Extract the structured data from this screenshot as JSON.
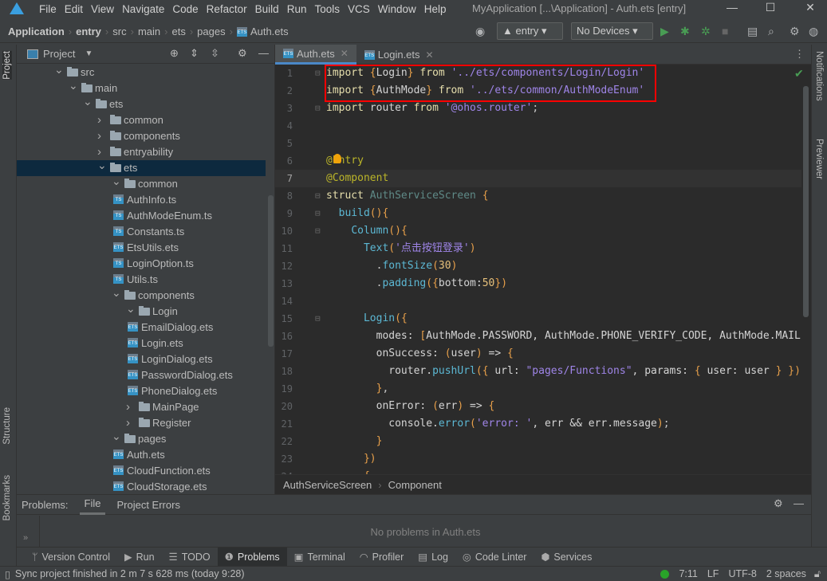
{
  "titlebar": {
    "menu": [
      "File",
      "Edit",
      "View",
      "Navigate",
      "Code",
      "Refactor",
      "Build",
      "Run",
      "Tools",
      "VCS",
      "Window",
      "Help"
    ],
    "title": "MyApplication [...\\Application] - Auth.ets [entry]"
  },
  "breadcrumb": [
    "Application",
    "entry",
    "src",
    "main",
    "ets",
    "pages",
    "Auth.ets"
  ],
  "toolbar": {
    "config": "entry",
    "device": "No Devices"
  },
  "left_strip": {
    "project": "Project",
    "structure": "Structure",
    "bookmarks": "Bookmarks"
  },
  "right_strip": {
    "notifications": "Notifications",
    "previewer": "Previewer"
  },
  "project_panel": {
    "title": "Project",
    "tree": [
      {
        "label": "src",
        "depth": 0,
        "type": "folder",
        "open": true
      },
      {
        "label": "main",
        "depth": 1,
        "type": "folder",
        "open": true
      },
      {
        "label": "ets",
        "depth": 2,
        "type": "folder",
        "open": true
      },
      {
        "label": "common",
        "depth": 3,
        "type": "folder",
        "open": false
      },
      {
        "label": "components",
        "depth": 3,
        "type": "folder",
        "open": false
      },
      {
        "label": "entryability",
        "depth": 3,
        "type": "folder",
        "open": false
      },
      {
        "label": "ets",
        "depth": 3,
        "type": "folder",
        "open": true,
        "selected": true
      },
      {
        "label": "common",
        "depth": 4,
        "type": "folder",
        "open": true
      },
      {
        "label": "AuthInfo.ts",
        "depth": 5,
        "type": "file"
      },
      {
        "label": "AuthModeEnum.ts",
        "depth": 5,
        "type": "file"
      },
      {
        "label": "Constants.ts",
        "depth": 5,
        "type": "file"
      },
      {
        "label": "EtsUtils.ets",
        "depth": 5,
        "type": "file"
      },
      {
        "label": "LoginOption.ts",
        "depth": 5,
        "type": "file"
      },
      {
        "label": "Utils.ts",
        "depth": 5,
        "type": "file"
      },
      {
        "label": "components",
        "depth": 4,
        "type": "folder",
        "open": true
      },
      {
        "label": "Login",
        "depth": 5,
        "type": "folder",
        "open": true
      },
      {
        "label": "EmailDialog.ets",
        "depth": 6,
        "type": "file"
      },
      {
        "label": "Login.ets",
        "depth": 6,
        "type": "file"
      },
      {
        "label": "LoginDialog.ets",
        "depth": 6,
        "type": "file"
      },
      {
        "label": "PasswordDialog.ets",
        "depth": 6,
        "type": "file"
      },
      {
        "label": "PhoneDialog.ets",
        "depth": 6,
        "type": "file"
      },
      {
        "label": "MainPage",
        "depth": 5,
        "type": "folder",
        "open": false
      },
      {
        "label": "Register",
        "depth": 5,
        "type": "folder",
        "open": false
      },
      {
        "label": "pages",
        "depth": 4,
        "type": "folder",
        "open": true
      },
      {
        "label": "Auth.ets",
        "depth": 5,
        "type": "file"
      },
      {
        "label": "CloudFunction.ets",
        "depth": 5,
        "type": "file"
      },
      {
        "label": "CloudStorage.ets",
        "depth": 5,
        "type": "file"
      }
    ]
  },
  "editor": {
    "tabs": [
      {
        "label": "Auth.ets",
        "active": true
      },
      {
        "label": "Login.ets",
        "active": false
      }
    ],
    "current_line": 7,
    "lines": [
      [
        [
          "import ",
          "k"
        ],
        [
          "{",
          "br"
        ],
        [
          "Login",
          "id"
        ],
        [
          "}",
          "br"
        ],
        [
          " from ",
          "k"
        ],
        [
          "'../ets/components/Login/Login'",
          "s"
        ]
      ],
      [
        [
          "import ",
          "k"
        ],
        [
          "{",
          "br"
        ],
        [
          "AuthMode",
          "id"
        ],
        [
          "}",
          "br"
        ],
        [
          " from ",
          "k"
        ],
        [
          "'../ets/common/AuthModeEnum'",
          "s"
        ]
      ],
      [
        [
          "import ",
          "k"
        ],
        [
          "router ",
          "id"
        ],
        [
          "from ",
          "k"
        ],
        [
          "'@ohos.router'",
          "s"
        ],
        [
          ";",
          "p"
        ]
      ],
      [],
      [],
      [
        [
          "@Entry",
          "d"
        ]
      ],
      [
        [
          "@Component",
          "d"
        ]
      ],
      [
        [
          "struct ",
          "k"
        ],
        [
          "AuthServiceScreen ",
          "cl"
        ],
        [
          "{",
          "br"
        ]
      ],
      [
        [
          "  ",
          " "
        ],
        [
          "build",
          "f"
        ],
        [
          "()",
          "br"
        ],
        [
          "{",
          "br"
        ]
      ],
      [
        [
          "    ",
          "p"
        ],
        [
          "Column",
          "f"
        ],
        [
          "()",
          "br"
        ],
        [
          "{",
          "br"
        ]
      ],
      [
        [
          "      ",
          "p"
        ],
        [
          "Text",
          "f"
        ],
        [
          "(",
          "br"
        ],
        [
          "'点击按钮登录'",
          "s"
        ],
        [
          ")",
          "br"
        ]
      ],
      [
        [
          "        .",
          "p"
        ],
        [
          "fontSize",
          "f"
        ],
        [
          "(",
          "br"
        ],
        [
          "30",
          "n"
        ],
        [
          ")",
          "br"
        ]
      ],
      [
        [
          "        .",
          "p"
        ],
        [
          "padding",
          "f"
        ],
        [
          "(",
          "br"
        ],
        [
          "{",
          "br"
        ],
        [
          "bottom:",
          "id"
        ],
        [
          "50",
          "n"
        ],
        [
          "}",
          "br"
        ],
        [
          ")",
          "br"
        ]
      ],
      [],
      [
        [
          "      ",
          "p"
        ],
        [
          "Login",
          "f"
        ],
        [
          "(",
          "br"
        ],
        [
          "{",
          "br"
        ]
      ],
      [
        [
          "        modes: ",
          "id"
        ],
        [
          "[",
          "br"
        ],
        [
          "AuthMode.PASSWORD, AuthMode.PHONE_VERIFY_CODE, AuthMode.MAIL",
          "id"
        ]
      ],
      [
        [
          "        onSuccess: ",
          "id"
        ],
        [
          "(",
          "br"
        ],
        [
          "user",
          "id"
        ],
        [
          ")",
          "br"
        ],
        [
          " => ",
          "id"
        ],
        [
          "{",
          "br"
        ]
      ],
      [
        [
          "          router.",
          "id"
        ],
        [
          "pushUrl",
          "f"
        ],
        [
          "(",
          "br"
        ],
        [
          "{",
          "br"
        ],
        [
          " url: ",
          "id"
        ],
        [
          "\"pages/Functions\"",
          "s"
        ],
        [
          ", params: ",
          "id"
        ],
        [
          "{",
          "br"
        ],
        [
          " user: user ",
          "id"
        ],
        [
          "}",
          "br"
        ],
        [
          " ",
          "p"
        ],
        [
          "}",
          "br"
        ],
        [
          ")",
          "br"
        ]
      ],
      [
        [
          "        ",
          "p"
        ],
        [
          "}",
          "br"
        ],
        [
          ",",
          "p"
        ]
      ],
      [
        [
          "        onError: ",
          "id"
        ],
        [
          "(",
          "br"
        ],
        [
          "err",
          "id"
        ],
        [
          ")",
          "br"
        ],
        [
          " => ",
          "id"
        ],
        [
          "{",
          "br"
        ]
      ],
      [
        [
          "          console.",
          "id"
        ],
        [
          "error",
          "f"
        ],
        [
          "(",
          "br"
        ],
        [
          "'error: '",
          "s"
        ],
        [
          ", err && err.message",
          "id"
        ],
        [
          ")",
          "br"
        ],
        [
          ";",
          "p"
        ]
      ],
      [
        [
          "        ",
          "p"
        ],
        [
          "}",
          "br"
        ]
      ],
      [
        [
          "      ",
          "p"
        ],
        [
          "}",
          "br"
        ],
        [
          ")",
          "br"
        ]
      ],
      [
        [
          "      ",
          "p"
        ],
        [
          "{",
          "br"
        ]
      ]
    ],
    "breadcrumb": [
      "AuthServiceScreen",
      "Component"
    ]
  },
  "problems": {
    "label": "Problems:",
    "tabs": [
      "File",
      "Project Errors"
    ],
    "active_tab": "File",
    "message": "No problems in Auth.ets"
  },
  "bottom_tools": [
    {
      "label": "Version Control",
      "icon": "branch-icon"
    },
    {
      "label": "Run",
      "icon": "play-icon"
    },
    {
      "label": "TODO",
      "icon": "list-icon"
    },
    {
      "label": "Problems",
      "icon": "warning-icon",
      "active": true
    },
    {
      "label": "Terminal",
      "icon": "terminal-icon"
    },
    {
      "label": "Profiler",
      "icon": "gauge-icon"
    },
    {
      "label": "Log",
      "icon": "log-icon"
    },
    {
      "label": "Code Linter",
      "icon": "linter-icon"
    },
    {
      "label": "Services",
      "icon": "services-icon"
    }
  ],
  "status": {
    "message": "Sync project finished in 2 m 7 s 628 ms (today 9:28)",
    "position": "7:11",
    "line_sep": "LF",
    "encoding": "UTF-8",
    "indent": "2 spaces"
  },
  "colors": {
    "accent": "#4a88c7",
    "highlight_box": "#ff0000",
    "status_ok": "#29a329"
  }
}
